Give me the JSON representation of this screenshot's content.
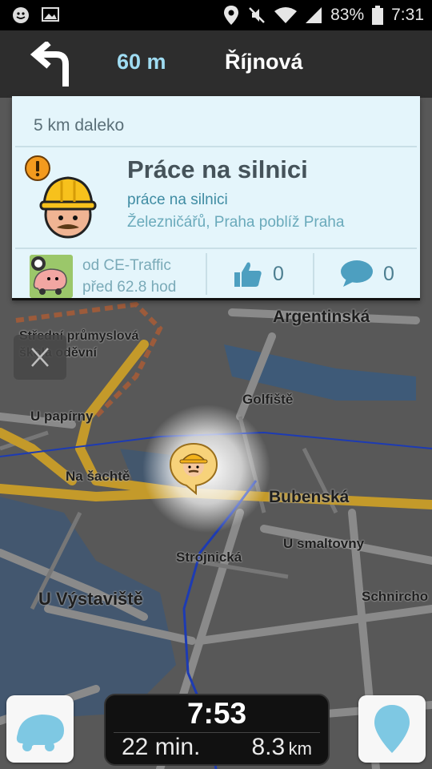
{
  "status_bar": {
    "battery": "83%",
    "time": "7:31",
    "icons": [
      "waze-notification-icon",
      "image-notification-icon",
      "location-icon",
      "mute-icon",
      "wifi-icon",
      "signal-icon"
    ]
  },
  "navigation": {
    "turn": "left-turn-arrow-icon",
    "distance": "60 m",
    "street": "Říjnová"
  },
  "alert": {
    "distance": "5 km daleko",
    "title": "Práce na silnici",
    "subtitle": "práce na silnici",
    "location": "Železničářů, Praha poblíž Praha",
    "source": "od CE-Traffic",
    "time_ago": "před 62.8 hod",
    "likes": "0",
    "comments": "0"
  },
  "map": {
    "labels": {
      "argentinska": "Argentinská",
      "skola": "Střední průmyslová škola oděvní",
      "golfiste": "Golfiště",
      "u_papirny": "U papírny",
      "na_sachte": "Na šachtě",
      "bubenska": "Bubenská",
      "u_smaltovny": "U smaltovny",
      "strojnicka": "Strojnická",
      "u_vystaviste": "U Výstaviště",
      "schnirch": "Schnircho"
    }
  },
  "trip": {
    "arrival": "7:53",
    "duration": "22 min.",
    "distance": "8.3",
    "distance_unit": "km"
  },
  "colors": {
    "nav_distance": "#9fdcf2",
    "card_bg": "#e4f5fb",
    "route": "#c49a2a"
  }
}
